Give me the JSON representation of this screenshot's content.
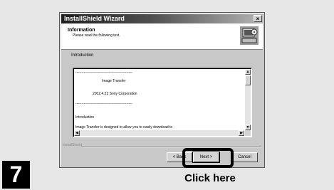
{
  "window": {
    "title": "InstallShield Wizard",
    "close_glyph": "×"
  },
  "header": {
    "title": "Information",
    "subtitle": "Please read the following text.",
    "icon": "installer-computer-icon"
  },
  "section_label": "Introduction",
  "document": {
    "lines": [
      "------------------------------------------------",
      "Image Transfer",
      "2002.4.22  Sony Corporation",
      "------------------------------------------------",
      "Introduction",
      "Image Transfer is designed to allow you to easily download to"
    ]
  },
  "brand": "InstallShield",
  "buttons": {
    "back": "< Back",
    "next": "Next >",
    "cancel": "Cancel"
  },
  "annotation": {
    "step_number": "7",
    "callout": "Click here"
  },
  "colors": {
    "titlebar_start": "#202020",
    "titlebar_end": "#b5b5b5",
    "dialog_face": "#c8c8c8"
  }
}
